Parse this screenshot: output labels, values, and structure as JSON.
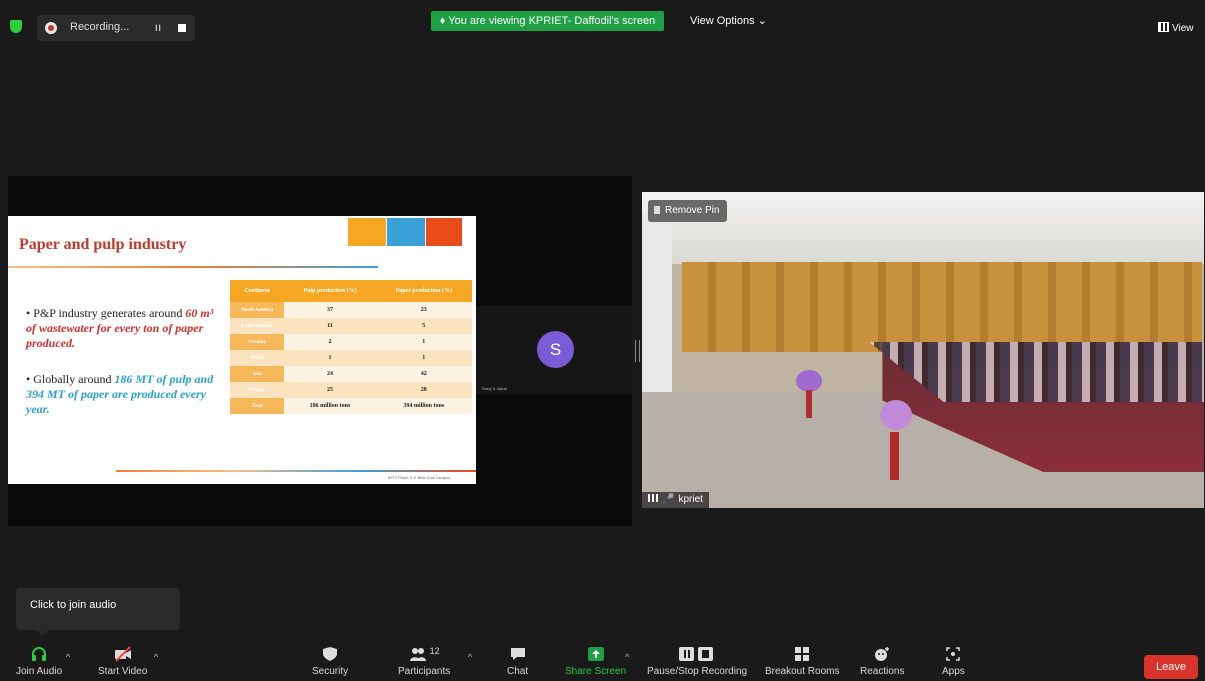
{
  "topbar": {
    "recording_label": "Recording...",
    "pause_glyph": "II",
    "viewing_banner": "You are viewing KPRIET- Daffodil's screen",
    "viewing_icon": "♦",
    "view_options": "View Options",
    "view_options_caret": "⌄",
    "view_button": "View"
  },
  "slide": {
    "title": "Paper and pulp industry",
    "bullet1_prefix": "P&P industry generates around",
    "bullet1_emph": "60 m³ of wastewater for every ton of paper produced.",
    "bullet2_prefix": "Globally around",
    "bullet2_emph": "186 MT of pulp and 394 MT of paper are produced every year.",
    "footer": "BITS Pilani, K K Birla Goa Campus",
    "table": {
      "headers": [
        "Continent",
        "Pulp production (%)",
        "Paper production (%)"
      ],
      "rows": [
        [
          "North America",
          "37",
          "23"
        ],
        [
          "Latin America",
          "11",
          "5"
        ],
        [
          "Oceania",
          "2",
          "1"
        ],
        [
          "Africa",
          "1",
          "1"
        ],
        [
          "Asia",
          "24",
          "42"
        ],
        [
          "Europe",
          "25",
          "28"
        ],
        [
          "Total",
          "186 million tons",
          "394 million tons"
        ]
      ]
    }
  },
  "participant": {
    "initial": "S",
    "name": "Saroj S. Baral"
  },
  "room_video": {
    "remove_pin": "Remove Pin",
    "name": "kpriet"
  },
  "tooltip": "Click to join audio",
  "toolbar": {
    "join_audio": "Join Audio",
    "start_video": "Start Video",
    "security": "Security",
    "participants": "Participants",
    "participants_count": "12",
    "chat": "Chat",
    "share_screen": "Share Screen",
    "pause_stop_recording": "Pause/Stop Recording",
    "breakout_rooms": "Breakout Rooms",
    "reactions": "Reactions",
    "apps": "Apps",
    "leave": "Leave",
    "caret": "^"
  }
}
